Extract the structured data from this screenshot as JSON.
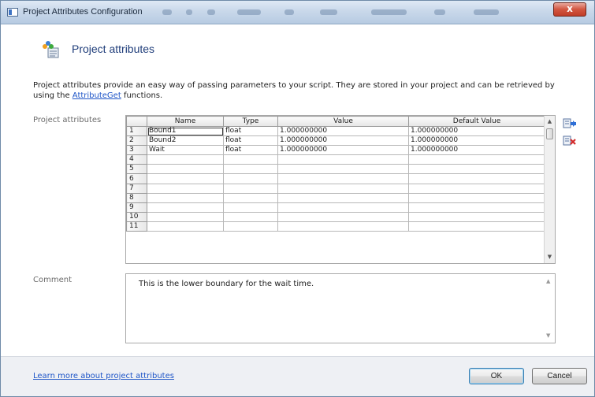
{
  "window": {
    "title": "Project Attributes Configuration",
    "close_label": "x"
  },
  "header": {
    "title": "Project attributes"
  },
  "description": {
    "text_before": "Project attributes provide an easy way of passing parameters to your script. They are stored in your project and can be retrieved by using the ",
    "link": "AttributeGet",
    "text_after": " functions."
  },
  "attributes_section": {
    "label": "Project attributes",
    "columns": [
      "Name",
      "Type",
      "Value",
      "Default Value"
    ],
    "rows": [
      {
        "num": "1",
        "name": "Bound1",
        "type": "float",
        "value": "1.000000000",
        "default": "1.000000000"
      },
      {
        "num": "2",
        "name": "Bound2",
        "type": "float",
        "value": "1.000000000",
        "default": "1.000000000"
      },
      {
        "num": "3",
        "name": "Wait",
        "type": "float",
        "value": "1.000000000",
        "default": "1.000000000"
      },
      {
        "num": "4",
        "name": "",
        "type": "",
        "value": "",
        "default": ""
      },
      {
        "num": "5",
        "name": "",
        "type": "",
        "value": "",
        "default": ""
      },
      {
        "num": "6",
        "name": "",
        "type": "",
        "value": "",
        "default": ""
      },
      {
        "num": "7",
        "name": "",
        "type": "",
        "value": "",
        "default": ""
      },
      {
        "num": "8",
        "name": "",
        "type": "",
        "value": "",
        "default": ""
      },
      {
        "num": "9",
        "name": "",
        "type": "",
        "value": "",
        "default": ""
      },
      {
        "num": "10",
        "name": "",
        "type": "",
        "value": "",
        "default": ""
      },
      {
        "num": "11",
        "name": "",
        "type": "",
        "value": "",
        "default": ""
      }
    ],
    "side_buttons": [
      "add-attribute-icon",
      "delete-attribute-icon"
    ]
  },
  "comment_section": {
    "label": "Comment",
    "text": "This is the lower boundary for the wait time."
  },
  "footer": {
    "learn_more": "Learn more about project attributes",
    "ok_label": "OK",
    "cancel_label": "Cancel"
  }
}
